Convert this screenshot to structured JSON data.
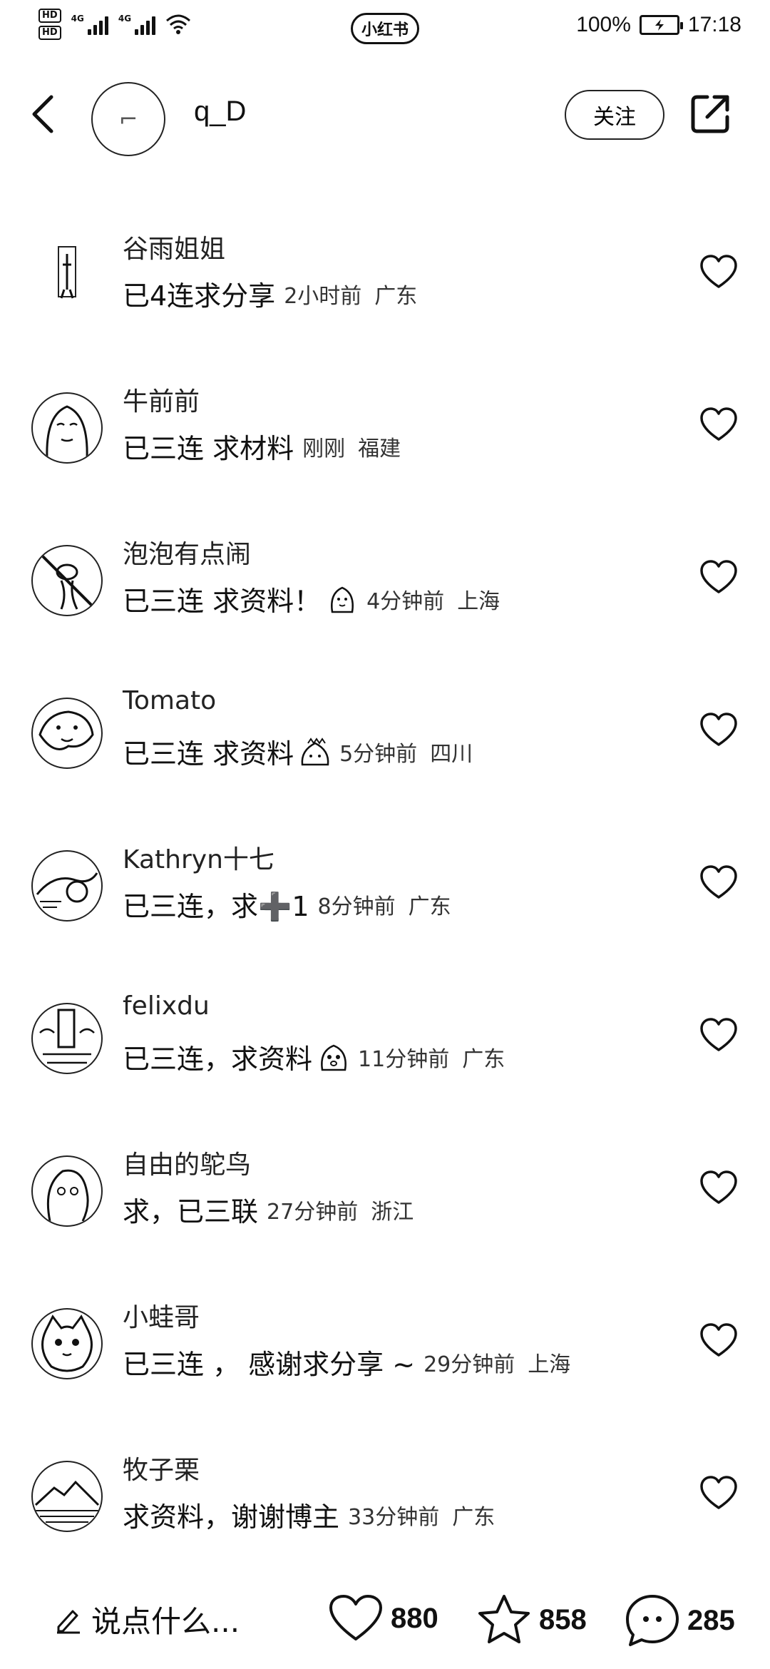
{
  "status_bar": {
    "hd1": "HD",
    "hd2": "HD",
    "net1": "4G",
    "net2": "4G",
    "app_badge": "小红书",
    "battery_percent": "100%",
    "time": "17:18"
  },
  "header": {
    "username": "q_D",
    "follow_label": "关注"
  },
  "comments": [
    {
      "name": "谷雨姐姐",
      "text": "已4连求分享",
      "time": "2小时前",
      "location": "广东"
    },
    {
      "name": "牛前前",
      "text": "已三连 求材料",
      "time": "刚刚",
      "location": "福建"
    },
    {
      "name": "泡泡有点闹",
      "text": "已三连 求资料！",
      "time": "4分钟前",
      "location": "上海"
    },
    {
      "name": "Tomato",
      "text": "已三连 求资料",
      "time": "5分钟前",
      "location": "四川"
    },
    {
      "name": "Kathryn十七",
      "text": "已三连，求➕1",
      "time": "8分钟前",
      "location": "广东"
    },
    {
      "name": "felixdu",
      "text": "已三连，求资料",
      "time": "11分钟前",
      "location": "广东"
    },
    {
      "name": "自由的鸵鸟",
      "text": "求，已三联",
      "time": "27分钟前",
      "location": "浙江"
    },
    {
      "name": "小蛙哥",
      "text": "已三连 ， 感谢求分享 ~",
      "time": "29分钟前",
      "location": "上海"
    },
    {
      "name": "牧子栗",
      "text": "求资料，谢谢博主",
      "time": "33分钟前",
      "location": "广东"
    }
  ],
  "bottom_bar": {
    "input_placeholder": "说点什么...",
    "likes": "880",
    "stars": "858",
    "comments": "285"
  }
}
